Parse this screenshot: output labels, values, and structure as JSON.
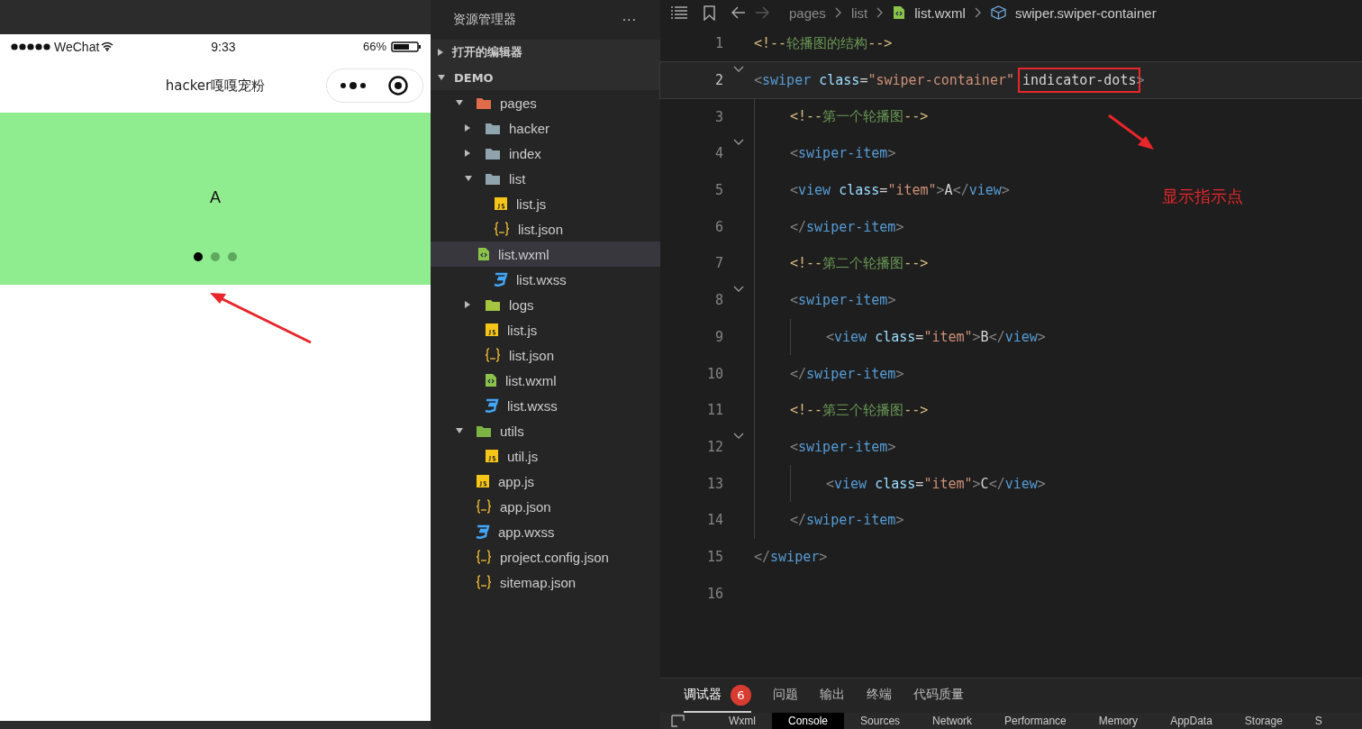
{
  "phone": {
    "status_bar": {
      "carrier": "WeChat",
      "time": "9:33",
      "battery": "66%"
    },
    "nav_title": "hacker嘎嘎宠粉",
    "swiper": {
      "slide_text": "A",
      "dots": [
        {
          "selected": true
        },
        {
          "selected": false
        },
        {
          "selected": false
        }
      ]
    }
  },
  "explorer": {
    "title": "资源管理器",
    "more": "···",
    "sections": [
      {
        "label": "打开的编辑器",
        "expanded": false
      },
      {
        "label": "DEMO",
        "expanded": true,
        "items": [
          {
            "label": "pages",
            "kind": "folder",
            "color": "#e06c4c",
            "expanded": true,
            "selected": false,
            "children": [
              {
                "label": "hacker",
                "kind": "folder",
                "color": "#90a4ae",
                "expanded": false,
                "selected": false
              },
              {
                "label": "index",
                "kind": "folder",
                "color": "#90a4ae",
                "expanded": false,
                "selected": false
              },
              {
                "label": "list",
                "kind": "folder",
                "color": "#90a4ae",
                "expanded": true,
                "selected": false,
                "children": [
                  {
                    "label": "list.js",
                    "kind": "js",
                    "selected": false
                  },
                  {
                    "label": "list.json",
                    "kind": "json",
                    "selected": false
                  },
                  {
                    "label": "list.wxml",
                    "kind": "wxml",
                    "selected": true
                  },
                  {
                    "label": "list.wxss",
                    "kind": "wxss",
                    "selected": false
                  }
                ]
              },
              {
                "label": "logs",
                "kind": "folder",
                "color": "#a5c440",
                "expanded": false,
                "selected": false
              },
              {
                "label": "list.js",
                "kind": "js",
                "selected": false
              },
              {
                "label": "list.json",
                "kind": "json",
                "selected": false
              },
              {
                "label": "list.wxml",
                "kind": "wxml",
                "selected": false
              },
              {
                "label": "list.wxss",
                "kind": "wxss",
                "selected": false
              }
            ]
          },
          {
            "label": "utils",
            "kind": "folder",
            "color": "#7cb342",
            "expanded": true,
            "selected": false,
            "children": [
              {
                "label": "util.js",
                "kind": "js",
                "selected": false
              }
            ]
          },
          {
            "label": "app.js",
            "kind": "js",
            "selected": false
          },
          {
            "label": "app.json",
            "kind": "json",
            "selected": false
          },
          {
            "label": "app.wxss",
            "kind": "wxss",
            "selected": false
          },
          {
            "label": "project.config.json",
            "kind": "json",
            "selected": false
          },
          {
            "label": "sitemap.json",
            "kind": "json",
            "selected": false
          }
        ]
      }
    ]
  },
  "editor": {
    "breadcrumbs": [
      {
        "label": "pages",
        "kind": "folder"
      },
      {
        "label": "list",
        "kind": "folder"
      },
      {
        "label": "list.wxml",
        "kind": "wxml"
      },
      {
        "label": "swiper.swiper-container",
        "kind": "element"
      }
    ],
    "lines": [
      {
        "number": "1",
        "foldable": false,
        "current": false,
        "tokens": [
          {
            "kind": "comment-mark",
            "text": "<!--"
          },
          {
            "kind": "comment",
            "text": "轮播图的结构"
          },
          {
            "kind": "comment-mark",
            "text": "-->"
          }
        ]
      },
      {
        "number": "2",
        "foldable": true,
        "current": true,
        "tokens": [
          {
            "kind": "punct",
            "text": "<"
          },
          {
            "kind": "tag",
            "text": "swiper"
          },
          {
            "kind": "attr",
            "text": " class"
          },
          {
            "kind": "plain",
            "text": "="
          },
          {
            "kind": "string",
            "text": "\"swiper-container\" "
          },
          {
            "kind": "plain",
            "text": "indicator-dots",
            "highlighted": true
          },
          {
            "kind": "punct",
            "text": ">"
          }
        ],
        "children": [
          {
            "number": "3",
            "foldable": false,
            "current": false,
            "tokens": [
              {
                "kind": "comment-mark",
                "text": "<!--"
              },
              {
                "kind": "comment",
                "text": "第一个轮播图"
              },
              {
                "kind": "comment-mark",
                "text": "-->"
              }
            ]
          },
          {
            "number": "4",
            "foldable": true,
            "current": false,
            "tokens": [
              {
                "kind": "punct",
                "text": "<"
              },
              {
                "kind": "tag",
                "text": "swiper-item"
              },
              {
                "kind": "punct",
                "text": ">"
              }
            ]
          },
          {
            "number": "5",
            "foldable": false,
            "current": false,
            "tokens": [
              {
                "kind": "punct",
                "text": "<"
              },
              {
                "kind": "tag",
                "text": "view"
              },
              {
                "kind": "attr",
                "text": " class"
              },
              {
                "kind": "plain",
                "text": "="
              },
              {
                "kind": "string",
                "text": "\"item\""
              },
              {
                "kind": "punct",
                "text": ">"
              },
              {
                "kind": "plain",
                "text": "A"
              },
              {
                "kind": "punct",
                "text": "</"
              },
              {
                "kind": "tag",
                "text": "view"
              },
              {
                "kind": "punct",
                "text": ">"
              }
            ]
          },
          {
            "number": "6",
            "foldable": false,
            "current": false,
            "tokens": [
              {
                "kind": "punct",
                "text": "</"
              },
              {
                "kind": "tag",
                "text": "swiper-item"
              },
              {
                "kind": "punct",
                "text": ">"
              }
            ]
          },
          {
            "number": "7",
            "foldable": false,
            "current": false,
            "tokens": [
              {
                "kind": "comment-mark",
                "text": "<!--"
              },
              {
                "kind": "comment",
                "text": "第二个轮播图"
              },
              {
                "kind": "comment-mark",
                "text": "-->"
              }
            ]
          },
          {
            "number": "8",
            "foldable": true,
            "current": false,
            "tokens": [
              {
                "kind": "punct",
                "text": "<"
              },
              {
                "kind": "tag",
                "text": "swiper-item"
              },
              {
                "kind": "punct",
                "text": ">"
              }
            ],
            "children": [
              {
                "number": "9",
                "foldable": false,
                "current": false,
                "tokens": [
                  {
                    "kind": "punct",
                    "text": "<"
                  },
                  {
                    "kind": "tag",
                    "text": "view"
                  },
                  {
                    "kind": "attr",
                    "text": " class"
                  },
                  {
                    "kind": "plain",
                    "text": "="
                  },
                  {
                    "kind": "string",
                    "text": "\"item\""
                  },
                  {
                    "kind": "punct",
                    "text": ">"
                  },
                  {
                    "kind": "plain",
                    "text": "B"
                  },
                  {
                    "kind": "punct",
                    "text": "</"
                  },
                  {
                    "kind": "tag",
                    "text": "view"
                  },
                  {
                    "kind": "punct",
                    "text": ">"
                  }
                ]
              }
            ]
          },
          {
            "number": "10",
            "foldable": false,
            "current": false,
            "tokens": [
              {
                "kind": "punct",
                "text": "</"
              },
              {
                "kind": "tag",
                "text": "swiper-item"
              },
              {
                "kind": "punct",
                "text": ">"
              }
            ]
          },
          {
            "number": "11",
            "foldable": false,
            "current": false,
            "tokens": [
              {
                "kind": "comment-mark",
                "text": "<!--"
              },
              {
                "kind": "comment",
                "text": "第三个轮播图"
              },
              {
                "kind": "comment-mark",
                "text": "-->"
              }
            ]
          },
          {
            "number": "12",
            "foldable": true,
            "current": false,
            "tokens": [
              {
                "kind": "punct",
                "text": "<"
              },
              {
                "kind": "tag",
                "text": "swiper-item"
              },
              {
                "kind": "punct",
                "text": ">"
              }
            ],
            "children": [
              {
                "number": "13",
                "foldable": false,
                "current": false,
                "tokens": [
                  {
                    "kind": "punct",
                    "text": "<"
                  },
                  {
                    "kind": "tag",
                    "text": "view"
                  },
                  {
                    "kind": "attr",
                    "text": " class"
                  },
                  {
                    "kind": "plain",
                    "text": "="
                  },
                  {
                    "kind": "string",
                    "text": "\"item\""
                  },
                  {
                    "kind": "punct",
                    "text": ">"
                  },
                  {
                    "kind": "plain",
                    "text": "C"
                  },
                  {
                    "kind": "punct",
                    "text": "</"
                  },
                  {
                    "kind": "tag",
                    "text": "view"
                  },
                  {
                    "kind": "punct",
                    "text": ">"
                  }
                ]
              }
            ]
          },
          {
            "number": "14",
            "foldable": false,
            "current": false,
            "tokens": [
              {
                "kind": "punct",
                "text": "</"
              },
              {
                "kind": "tag",
                "text": "swiper-item"
              },
              {
                "kind": "punct",
                "text": ">"
              }
            ]
          }
        ]
      },
      {
        "number": "15",
        "foldable": false,
        "current": false,
        "tokens": [
          {
            "kind": "punct",
            "text": "</"
          },
          {
            "kind": "tag",
            "text": "swiper"
          },
          {
            "kind": "punct",
            "text": ">"
          }
        ]
      },
      {
        "number": "16",
        "foldable": false,
        "current": false
      }
    ],
    "annotation": "显示指示点"
  },
  "panel": {
    "tabs": [
      {
        "label": "调试器",
        "badge": "6",
        "selected": true
      },
      {
        "label": "问题",
        "selected": false
      },
      {
        "label": "输出",
        "selected": false
      },
      {
        "label": "终端",
        "selected": false
      },
      {
        "label": "代码质量",
        "selected": false
      }
    ],
    "devtools_tabs": [
      {
        "label": "Wxml",
        "selected": false
      },
      {
        "label": "Console",
        "selected": true
      },
      {
        "label": "Sources",
        "selected": false
      },
      {
        "label": "Network",
        "selected": false
      },
      {
        "label": "Performance",
        "selected": false
      },
      {
        "label": "Memory",
        "selected": false
      },
      {
        "label": "AppData",
        "selected": false
      },
      {
        "label": "Storage",
        "selected": false
      },
      {
        "label": "S",
        "selected": false
      }
    ]
  }
}
